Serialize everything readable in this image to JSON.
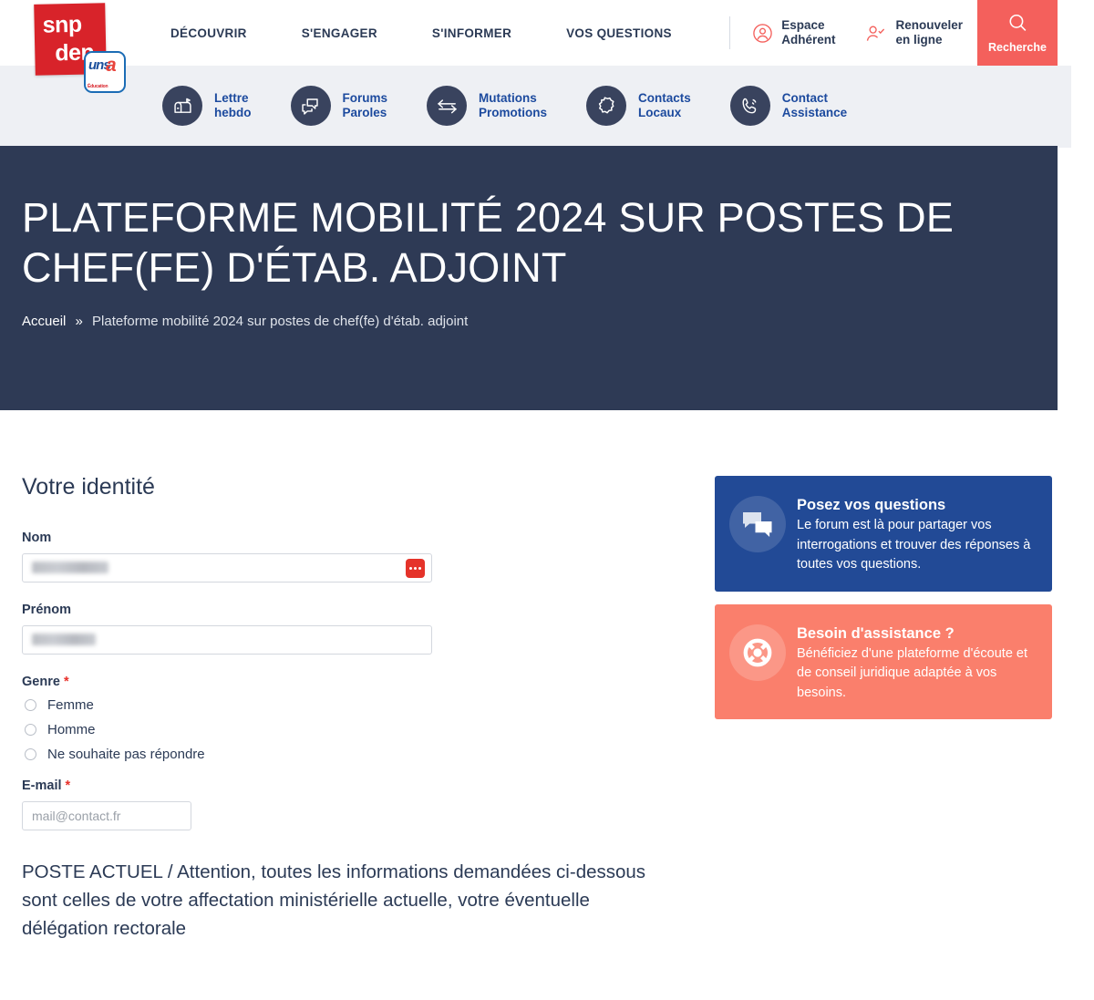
{
  "brand": {
    "logo_line1": "snp",
    "logo_line2": "den",
    "badge_text": "uns",
    "badge_accent": "a",
    "badge_sub": "Éducation",
    "colors": {
      "logo_red": "#d8232a",
      "accent_coral": "#f4605c",
      "navy": "#2e3a55",
      "link_blue": "#1c4a9e",
      "card_blue": "#224a96",
      "card_coral": "#fa7f6c"
    }
  },
  "header": {
    "nav": [
      {
        "label": "DÉCOUVRIR"
      },
      {
        "label": "S'ENGAGER"
      },
      {
        "label": "S'INFORMER"
      },
      {
        "label": "VOS QUESTIONS"
      }
    ],
    "actions": [
      {
        "icon": "user-circle-icon",
        "line1": "Espace",
        "line2": "Adhérent"
      },
      {
        "icon": "user-check-icon",
        "line1": "Renouveler",
        "line2": "en ligne"
      }
    ],
    "search": {
      "icon": "search-icon",
      "label": "Recherche"
    }
  },
  "subnav": [
    {
      "icon": "mailbox-icon",
      "label": "Lettre\nhebdo"
    },
    {
      "icon": "chat-bubbles-icon",
      "label": "Forums\nParoles"
    },
    {
      "icon": "exchange-arrows-icon",
      "label": "Mutations\nPromotions"
    },
    {
      "icon": "france-map-icon",
      "label": "Contacts\nLocaux"
    },
    {
      "icon": "phone-ring-icon",
      "label": "Contact\nAssistance"
    }
  ],
  "hero": {
    "title": "PLATEFORME MOBILITÉ 2024 SUR POSTES DE CHEF(FE) D'ÉTAB. ADJOINT",
    "breadcrumb": {
      "home": "Accueil",
      "separator": "»",
      "current": "Plateforme mobilité 2024 sur postes de chef(fe) d'étab. adjoint"
    }
  },
  "form": {
    "section_title": "Votre identité",
    "nom": {
      "label": "Nom",
      "value": "",
      "redacted": true,
      "password_manager_icon": "lastpass-icon"
    },
    "prenom": {
      "label": "Prénom",
      "value": "",
      "redacted": true
    },
    "genre": {
      "label": "Genre",
      "required_marker": "*",
      "options": [
        {
          "label": "Femme",
          "selected": false
        },
        {
          "label": "Homme",
          "selected": false
        },
        {
          "label": "Ne souhaite pas répondre",
          "selected": false
        }
      ]
    },
    "email": {
      "label": "E-mail",
      "required_marker": "*",
      "placeholder": "mail@contact.fr",
      "value": ""
    },
    "notice": "POSTE ACTUEL / Attention, toutes les informations demandées ci-dessous sont celles de votre affectation ministérielle actuelle, votre éventuelle délégation rectorale"
  },
  "sidebar": {
    "cards": [
      {
        "icon": "chat-bubbles-icon",
        "title": "Posez vos questions",
        "text": "Le forum est là pour partager vos interrogations et trouver des réponses à toutes vos questions.",
        "color": "#224a96"
      },
      {
        "icon": "lifebuoy-icon",
        "title": "Besoin d'assistance ?",
        "text": "Bénéficiez d'une plateforme d'écoute et de conseil juridique adaptée à vos besoins.",
        "color": "#fa7f6c"
      }
    ]
  }
}
